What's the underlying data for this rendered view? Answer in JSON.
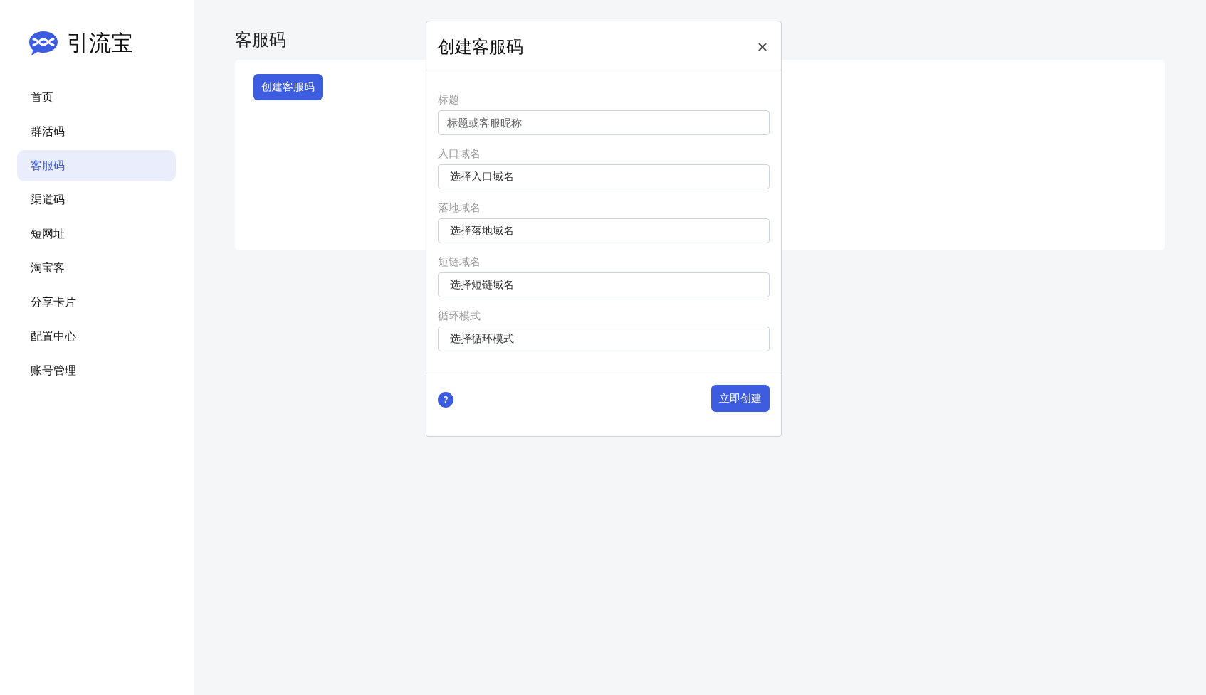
{
  "sidebar": {
    "logo_text": "引流宝",
    "items": [
      {
        "label": "首页",
        "selected": false
      },
      {
        "label": "群活码",
        "selected": false
      },
      {
        "label": "客服码",
        "selected": true
      },
      {
        "label": "渠道码",
        "selected": false
      },
      {
        "label": "短网址",
        "selected": false
      },
      {
        "label": "淘宝客",
        "selected": false
      },
      {
        "label": "分享卡片",
        "selected": false
      },
      {
        "label": "配置中心",
        "selected": false
      },
      {
        "label": "账号管理",
        "selected": false
      }
    ]
  },
  "page": {
    "title": "客服码",
    "create_button": "创建客服码"
  },
  "modal": {
    "title": "创建客服码",
    "fields": [
      {
        "kind": "input",
        "label": "标题",
        "placeholder": "标题或客服昵称"
      },
      {
        "kind": "select",
        "label": "入口域名",
        "value": "选择入口域名"
      },
      {
        "kind": "select",
        "label": "落地域名",
        "value": "选择落地域名"
      },
      {
        "kind": "select",
        "label": "短链域名",
        "value": "选择短链域名"
      },
      {
        "kind": "select",
        "label": "循环模式",
        "value": "选择循环模式"
      }
    ],
    "help": "?",
    "submit_button": "立即创建"
  }
}
